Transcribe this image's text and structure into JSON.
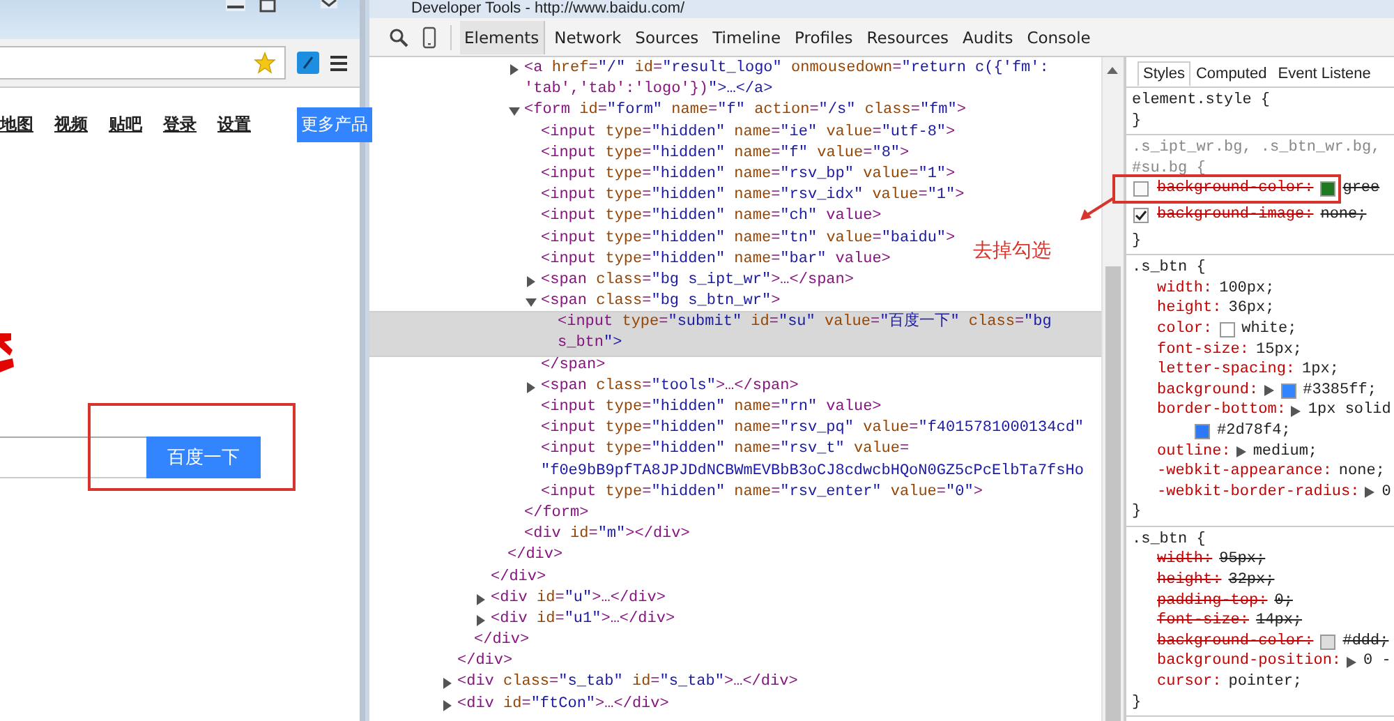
{
  "browser": {
    "nav_links": [
      "地图",
      "视频",
      "贴吧",
      "登录",
      "设置"
    ],
    "more_button": "更多产品",
    "search_button": "百度一下"
  },
  "devtools": {
    "title": "Developer Tools - http://www.baidu.com/",
    "tabs": [
      {
        "label": "Elements",
        "selected": true
      },
      {
        "label": "Network",
        "selected": false
      },
      {
        "label": "Sources",
        "selected": false
      },
      {
        "label": "Timeline",
        "selected": false
      },
      {
        "label": "Profiles",
        "selected": false
      },
      {
        "label": "Resources",
        "selected": false
      },
      {
        "label": "Audits",
        "selected": false
      },
      {
        "label": "Console",
        "selected": false
      }
    ],
    "tree": [
      {
        "close": "</div>",
        "children": [
          {
            "close": "</div>",
            "children": [
              {
                "close": "</div>",
                "children": [
                  {
                    "close": "</div>",
                    "children": [
                      {
                        "lines": [
                          "<a href=\"/\" id=\"result_logo\" onmousedown=\"return c({'fm':",
                          "'tab','tab':'logo'})\">…</a>"
                        ],
                        "expanded": false,
                        "selected": false
                      },
                      {
                        "lines": [
                          "<form id=\"form\" name=\"f\" action=\"/s\" class=\"fm\">"
                        ],
                        "expanded": true,
                        "selected": false,
                        "close": "</form>",
                        "children": [
                          {
                            "lines": [
                              "<input type=\"hidden\" name=\"ie\" value=\"utf-8\">"
                            ],
                            "selected": false
                          },
                          {
                            "lines": [
                              "<input type=\"hidden\" name=\"f\" value=\"8\">"
                            ],
                            "selected": false
                          },
                          {
                            "lines": [
                              "<input type=\"hidden\" name=\"rsv_bp\" value=\"1\">"
                            ],
                            "selected": false
                          },
                          {
                            "lines": [
                              "<input type=\"hidden\" name=\"rsv_idx\" value=\"1\">"
                            ],
                            "selected": false
                          },
                          {
                            "lines": [
                              "<input type=\"hidden\" name=\"ch\" value>"
                            ],
                            "selected": false
                          },
                          {
                            "lines": [
                              "<input type=\"hidden\" name=\"tn\" value=\"baidu\">"
                            ],
                            "selected": false
                          },
                          {
                            "lines": [
                              "<input type=\"hidden\" name=\"bar\" value>"
                            ],
                            "selected": false
                          },
                          {
                            "lines": [
                              "<span class=\"bg s_ipt_wr\">…</span>"
                            ],
                            "expanded": false,
                            "selected": false
                          },
                          {
                            "lines": [
                              "<span class=\"bg s_btn_wr\">"
                            ],
                            "expanded": true,
                            "selected": false,
                            "close": "</span>",
                            "children": [
                              {
                                "lines": [
                                  "<input type=\"submit\" id=\"su\" value=\"百度一下\" class=\"bg",
                                  "s_btn\">"
                                ],
                                "selected": true
                              }
                            ]
                          },
                          {
                            "lines": [
                              "<span class=\"tools\">…</span>"
                            ],
                            "expanded": false,
                            "selected": false
                          },
                          {
                            "lines": [
                              "<input type=\"hidden\" name=\"rn\" value>"
                            ],
                            "selected": false
                          },
                          {
                            "lines": [
                              "<input type=\"hidden\" name=\"rsv_pq\" value=\"f4015781000134cd\""
                            ],
                            "selected": false
                          },
                          {
                            "lines": [
                              "<input type=\"hidden\" name=\"rsv_t\" value=",
                              "\"f0e9bB9pfTA8JPJDdNCBWmEVBbB3oCJ8cdwcbHQoN0GZ5cPcElbTa7fsHo"
                            ],
                            "selected": false
                          },
                          {
                            "lines": [
                              "<input type=\"hidden\" name=\"rsv_enter\" value=\"0\">"
                            ],
                            "selected": false
                          }
                        ]
                      },
                      {
                        "lines": [
                          "<div id=\"m\"></div>"
                        ],
                        "selected": false
                      }
                    ]
                  }
                ]
              },
              {
                "lines": [
                  "<div id=\"u\">…</div>"
                ],
                "expanded": false,
                "selected": false
              },
              {
                "lines": [
                  "<div id=\"u1\">…</div>"
                ],
                "expanded": false,
                "selected": false
              }
            ]
          }
        ]
      },
      {
        "lines": [
          "<div class=\"s_tab\" id=\"s_tab\">…</div>"
        ],
        "expanded": false,
        "selected": false
      },
      {
        "lines": [
          "<div id=\"ftCon\">…</div>"
        ],
        "expanded": false,
        "selected": false
      }
    ],
    "style_tabs": [
      {
        "label": "Styles",
        "selected": true
      },
      {
        "label": "Computed",
        "selected": false
      },
      {
        "label": "Event Listene",
        "selected": false
      }
    ],
    "rules": [
      {
        "selector": [
          "element.style {"
        ],
        "matched": true,
        "close": "}"
      },
      {
        "selector": [
          ".s_ipt_wr.bg, .s_btn_wr.bg,",
          "#su.bg {"
        ],
        "matched": false,
        "close": "}",
        "props": [
          {
            "kind": "toggle",
            "checked": false,
            "name": "background-color:",
            "value": "gree",
            "struck": true,
            "expandable": false,
            "color": "#1f7a1f"
          },
          {
            "kind": "toggle",
            "checked": true,
            "name": "background-image:",
            "value": "none;",
            "struck": true,
            "expandable": false
          }
        ]
      },
      {
        "selector": [
          ".s_btn {"
        ],
        "matched": true,
        "close": "}",
        "props": [
          {
            "kind": "plain",
            "name": "width:",
            "value": "100px;",
            "struck": false,
            "expandable": false
          },
          {
            "kind": "plain",
            "name": "height:",
            "value": "36px;",
            "struck": false,
            "expandable": false
          },
          {
            "kind": "plain",
            "name": "color:",
            "value": "white;",
            "struck": false,
            "expandable": false,
            "color": "#ffffff"
          },
          {
            "kind": "plain",
            "name": "font-size:",
            "value": "15px;",
            "struck": false,
            "expandable": false
          },
          {
            "kind": "plain",
            "name": "letter-spacing:",
            "value": "1px;",
            "struck": false,
            "expandable": false
          },
          {
            "kind": "plain",
            "name": "background:",
            "value": "#3385ff;",
            "struck": false,
            "expandable": true,
            "color": "#3385ff"
          },
          {
            "kind": "plain",
            "name": "border-bottom:",
            "value": "1px solid",
            "struck": false,
            "expandable": true,
            "wrap": {
              "text": "#2d78f4;",
              "color": "#2d78f4"
            }
          },
          {
            "kind": "plain",
            "name": "outline:",
            "value": "medium;",
            "struck": false,
            "expandable": true
          },
          {
            "kind": "plain",
            "name": "-webkit-appearance:",
            "value": "none;",
            "struck": false,
            "expandable": false
          },
          {
            "kind": "plain",
            "name": "-webkit-border-radius:",
            "value": "0",
            "struck": false,
            "expandable": true
          }
        ]
      },
      {
        "selector": [
          ".s_btn {"
        ],
        "matched": true,
        "close": "}",
        "props": [
          {
            "kind": "plain",
            "name": "width:",
            "value": "95px;",
            "struck": true,
            "expandable": false
          },
          {
            "kind": "plain",
            "name": "height:",
            "value": "32px;",
            "struck": true,
            "expandable": false
          },
          {
            "kind": "plain",
            "name": "padding-top:",
            "value": "0;",
            "struck": true,
            "expandable": false
          },
          {
            "kind": "plain",
            "name": "font-size:",
            "value": "14px;",
            "struck": true,
            "expandable": false
          },
          {
            "kind": "plain",
            "name": "background-color:",
            "value": "#ddd;",
            "struck": true,
            "expandable": false,
            "color": "#dddddd"
          },
          {
            "kind": "plain",
            "name": "background-position:",
            "value": "0 -",
            "struck": false,
            "expandable": true
          },
          {
            "kind": "plain",
            "name": "cursor:",
            "value": "pointer;",
            "struck": false,
            "expandable": false
          }
        ]
      }
    ]
  },
  "annotation": {
    "text": "去掉勾选"
  }
}
